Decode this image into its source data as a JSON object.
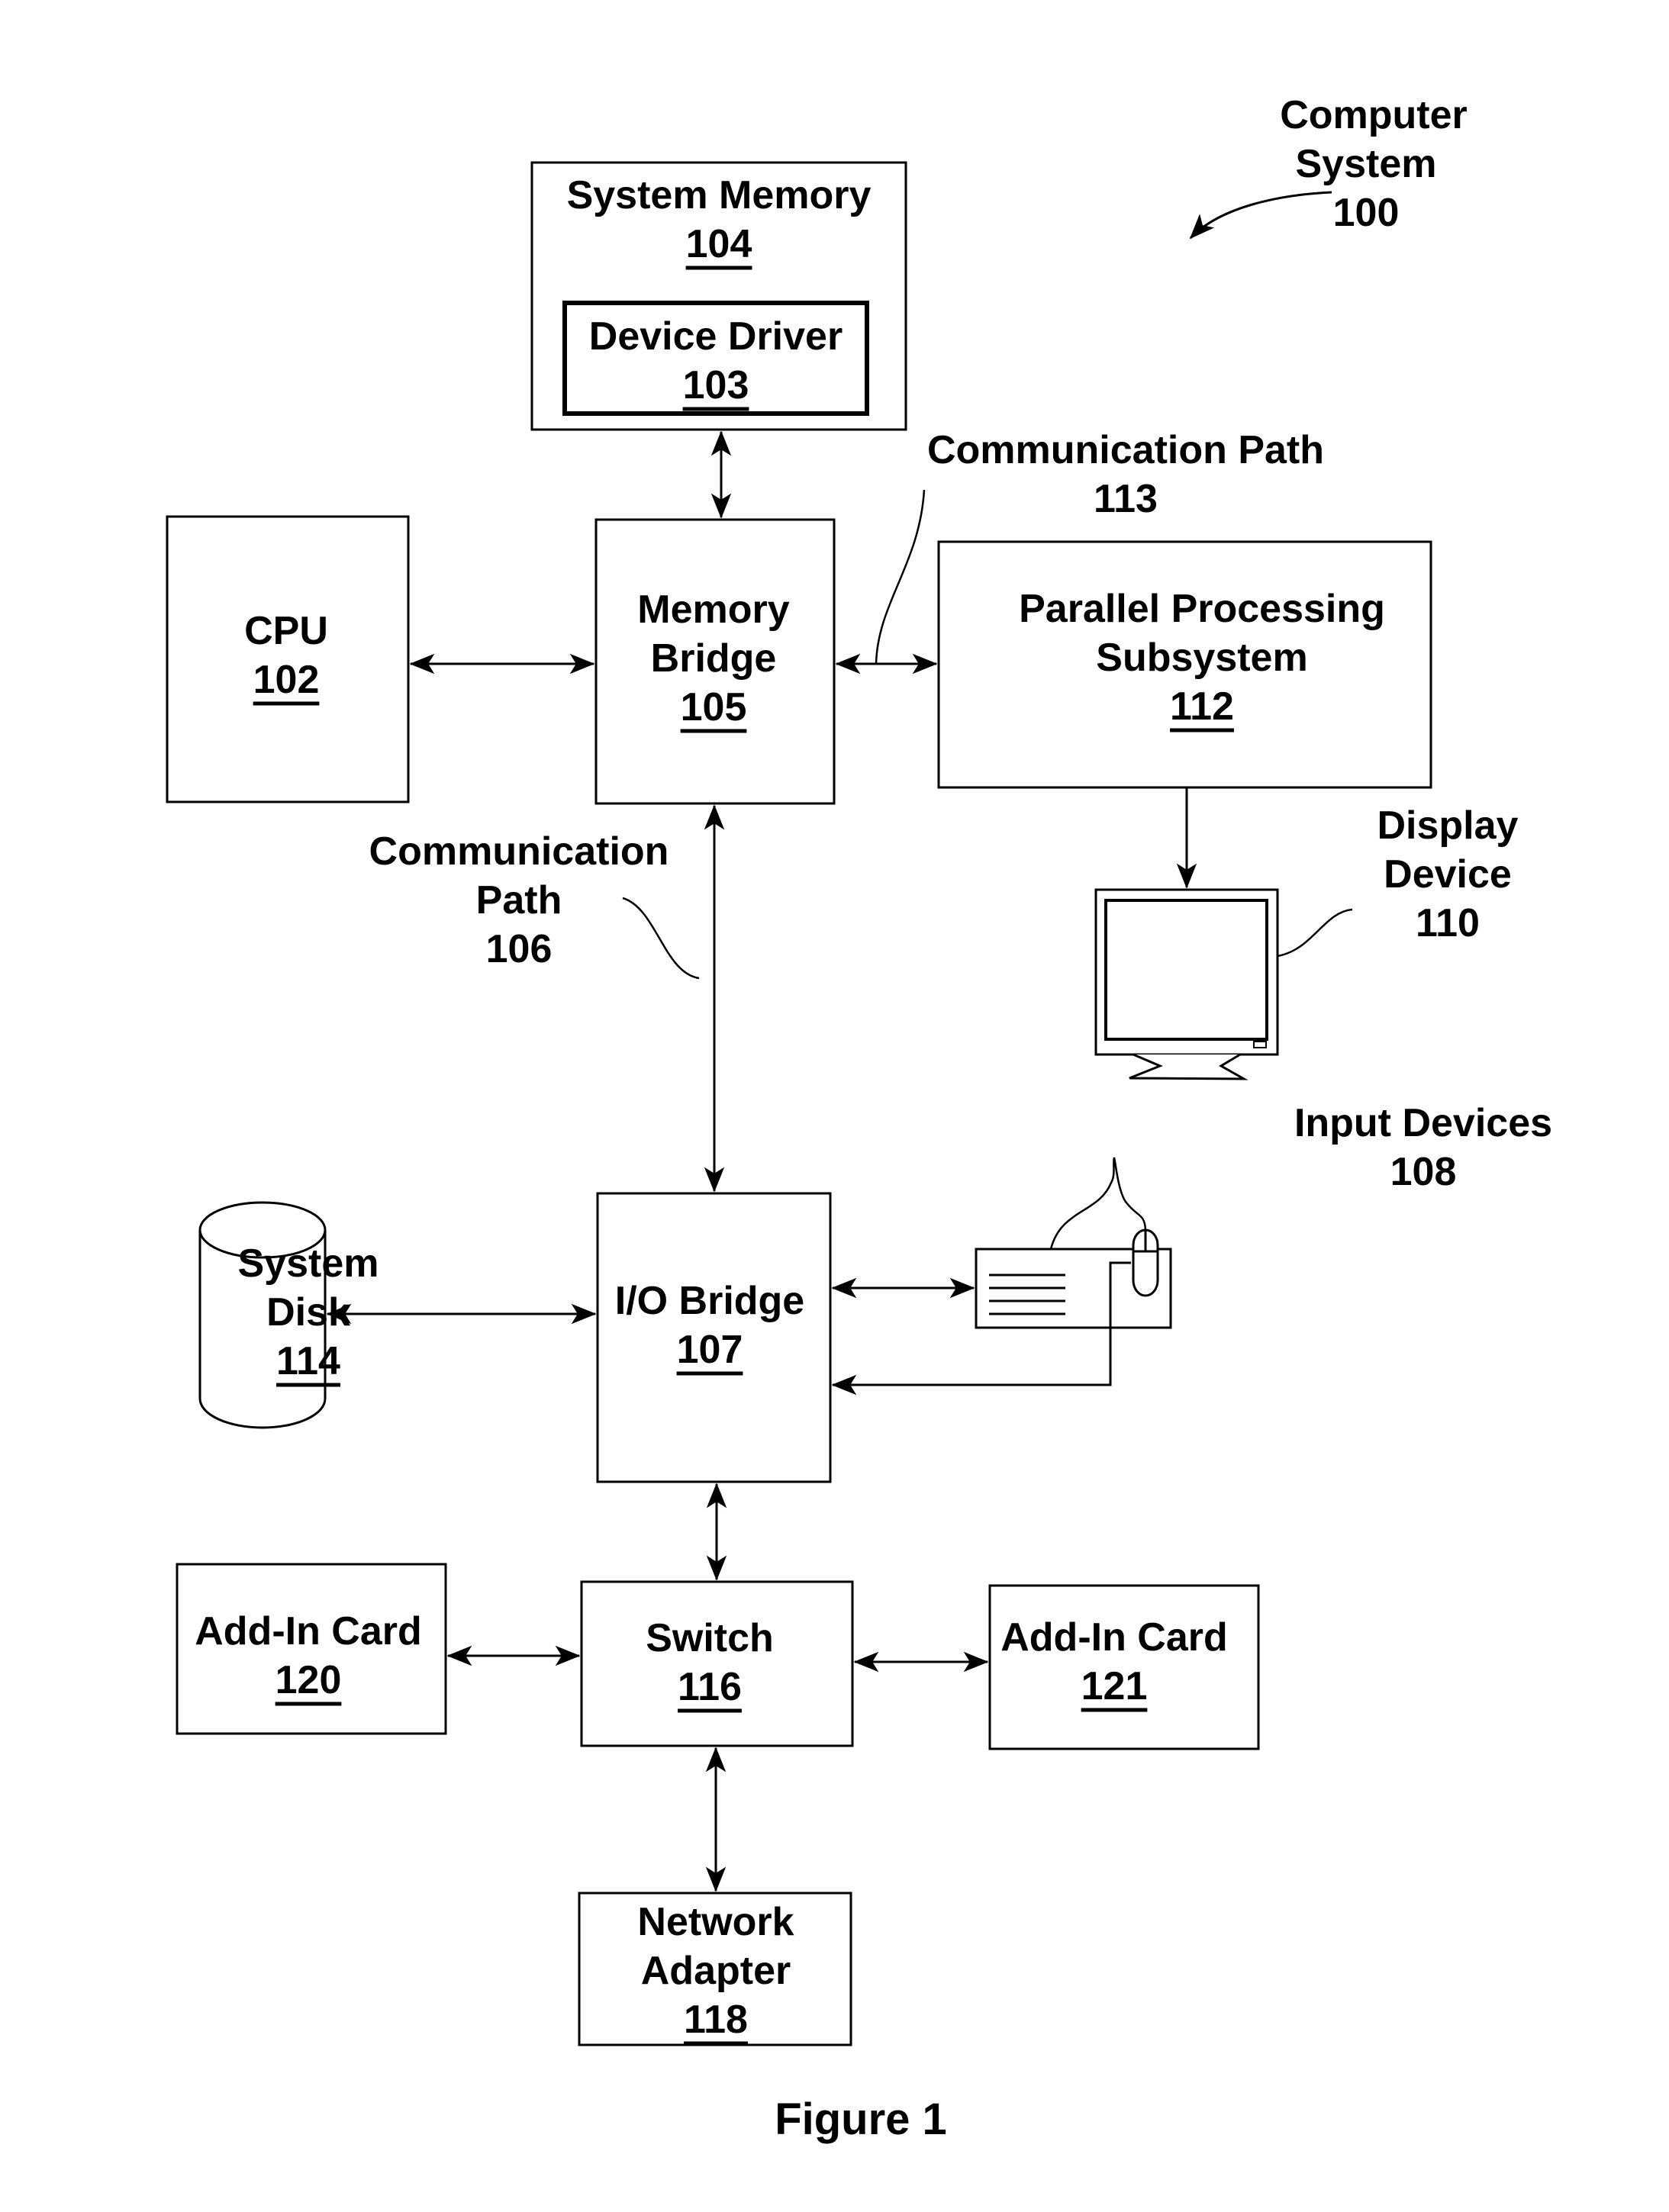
{
  "figure_title": "Figure 1",
  "system_label": {
    "lines": [
      "Computer",
      "System"
    ],
    "ref": "100"
  },
  "components": {
    "system_memory": {
      "lines": [
        "System Memory"
      ],
      "ref": "104"
    },
    "device_driver": {
      "lines": [
        "Device Driver"
      ],
      "ref": "103"
    },
    "cpu": {
      "lines": [
        "CPU"
      ],
      "ref": "102"
    },
    "memory_bridge": {
      "lines": [
        "Memory",
        "Bridge"
      ],
      "ref": "105"
    },
    "parallel_processing": {
      "lines": [
        "Parallel Processing",
        "Subsystem"
      ],
      "ref": "112"
    },
    "io_bridge": {
      "lines": [
        "I/O Bridge"
      ],
      "ref": "107"
    },
    "system_disk": {
      "lines": [
        "System",
        "Disk"
      ],
      "ref": "114"
    },
    "switch": {
      "lines": [
        "Switch"
      ],
      "ref": "116"
    },
    "add_in_card_120": {
      "lines": [
        "Add-In Card"
      ],
      "ref": "120"
    },
    "add_in_card_121": {
      "lines": [
        "Add-In Card"
      ],
      "ref": "121"
    },
    "network_adapter": {
      "lines": [
        "Network",
        "Adapter"
      ],
      "ref": "118"
    }
  },
  "callouts": {
    "comm_path_113": {
      "lines": [
        "Communication Path"
      ],
      "ref": "113"
    },
    "comm_path_106": {
      "lines": [
        "Communication",
        "Path"
      ],
      "ref": "106"
    },
    "display_device": {
      "lines": [
        "Display",
        "Device"
      ],
      "ref": "110"
    },
    "input_devices": {
      "lines": [
        "Input Devices"
      ],
      "ref": "108"
    }
  }
}
